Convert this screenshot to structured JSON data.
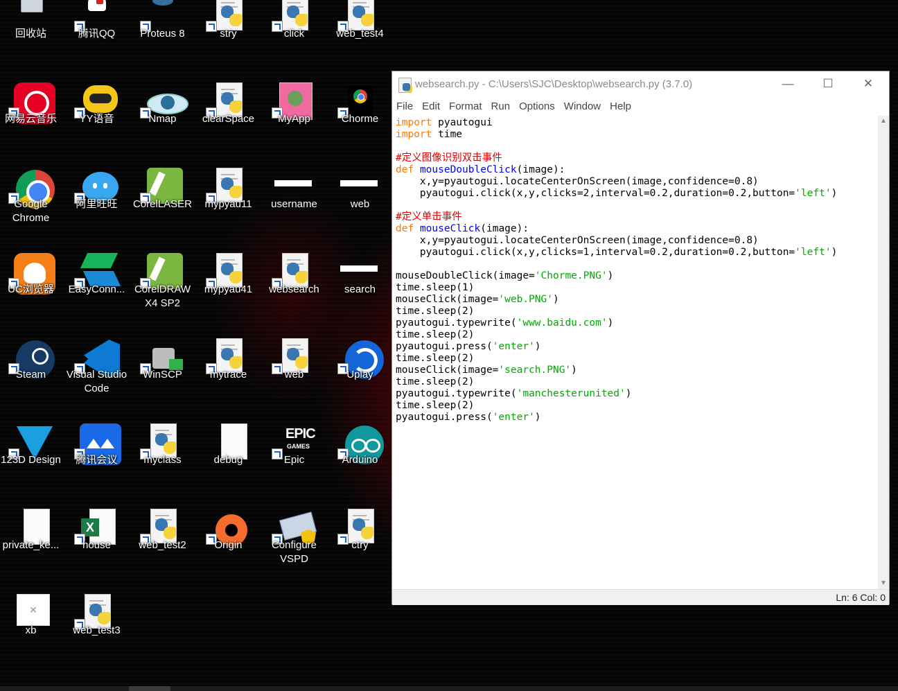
{
  "desktop": {
    "icons": [
      {
        "label": "回收站",
        "kind": "recycle"
      },
      {
        "label": "腾讯QQ",
        "kind": "qq"
      },
      {
        "label": "Proteus 8",
        "kind": "proteus"
      },
      {
        "label": "stry",
        "kind": "py"
      },
      {
        "label": "click",
        "kind": "py"
      },
      {
        "label": "web_test4",
        "kind": "py"
      },
      {
        "label": "网易云音乐",
        "kind": "netease"
      },
      {
        "label": "YY语音",
        "kind": "yy"
      },
      {
        "label": "Nmap",
        "kind": "nmap"
      },
      {
        "label": "clearSpace",
        "kind": "py"
      },
      {
        "label": "MyApp",
        "kind": "myapp"
      },
      {
        "label": "Chorme",
        "kind": "chorme"
      },
      {
        "label": "Google Chrome",
        "kind": "chrome"
      },
      {
        "label": "阿里旺旺",
        "kind": "aliww"
      },
      {
        "label": "CorelLASER",
        "kind": "corel"
      },
      {
        "label": "mypyau11",
        "kind": "py"
      },
      {
        "label": "username",
        "kind": "bar"
      },
      {
        "label": "web",
        "kind": "bar"
      },
      {
        "label": "UC浏览器",
        "kind": "uc"
      },
      {
        "label": "EasyConn...",
        "kind": "easyconn"
      },
      {
        "label": "CorelDRAW X4 SP2",
        "kind": "corel"
      },
      {
        "label": "mypyau41",
        "kind": "py"
      },
      {
        "label": "websearch",
        "kind": "py"
      },
      {
        "label": "search",
        "kind": "bar"
      },
      {
        "label": "Steam",
        "kind": "steam"
      },
      {
        "label": "Visual Studio Code",
        "kind": "vscode"
      },
      {
        "label": "WinSCP",
        "kind": "winscp"
      },
      {
        "label": "mytrace",
        "kind": "py"
      },
      {
        "label": "web",
        "kind": "py"
      },
      {
        "label": "Uplay",
        "kind": "uplay"
      },
      {
        "label": "123D Design",
        "kind": "d123"
      },
      {
        "label": "腾讯会议",
        "kind": "meeting"
      },
      {
        "label": "myclass",
        "kind": "py"
      },
      {
        "label": "debug",
        "kind": "doc"
      },
      {
        "label": "Epic",
        "kind": "epic"
      },
      {
        "label": "Arduino",
        "kind": "arduino"
      },
      {
        "label": "private_ke...",
        "kind": "doc"
      },
      {
        "label": "house",
        "kind": "excel"
      },
      {
        "label": "web_test2",
        "kind": "py"
      },
      {
        "label": "Origin",
        "kind": "origin"
      },
      {
        "label": "Configure VSPD",
        "kind": "vspd"
      },
      {
        "label": "ctry",
        "kind": "py"
      },
      {
        "label": "xb",
        "kind": "xb"
      },
      {
        "label": "web_test3",
        "kind": "py"
      }
    ]
  },
  "window": {
    "title": "websearch.py - C:\\Users\\SJC\\Desktop\\websearch.py (3.7.0)",
    "minimize": "—",
    "maximize": "☐",
    "close": "✕",
    "menu": [
      "File",
      "Edit",
      "Format",
      "Run",
      "Options",
      "Window",
      "Help"
    ],
    "code": [
      [
        {
          "t": "import",
          "c": "kw"
        },
        {
          "t": " pyautogui"
        }
      ],
      [
        {
          "t": "import",
          "c": "kw"
        },
        {
          "t": " time"
        }
      ],
      [],
      [
        {
          "t": "#定义图像识别双击事件",
          "c": "cm"
        }
      ],
      [
        {
          "t": "def",
          "c": "kw"
        },
        {
          "t": " "
        },
        {
          "t": "mouseDoubleClick",
          "c": "df"
        },
        {
          "t": "(image):"
        }
      ],
      [
        {
          "t": "    x,y=pyautogui.locateCenterOnScreen(image,confidence=0.8)"
        }
      ],
      [
        {
          "t": "    pyautogui.click(x,y,clicks=2,interval=0.2,duration=0.2,button="
        },
        {
          "t": "'left'",
          "c": "st"
        },
        {
          "t": ")"
        }
      ],
      [],
      [
        {
          "t": "#定义单击事件",
          "c": "cm"
        }
      ],
      [
        {
          "t": "def",
          "c": "kw"
        },
        {
          "t": " "
        },
        {
          "t": "mouseClick",
          "c": "df"
        },
        {
          "t": "(image):"
        }
      ],
      [
        {
          "t": "    x,y=pyautogui.locateCenterOnScreen(image,confidence=0.8)"
        }
      ],
      [
        {
          "t": "    pyautogui.click(x,y,clicks=1,interval=0.2,duration=0.2,button="
        },
        {
          "t": "'left'",
          "c": "st"
        },
        {
          "t": ")"
        }
      ],
      [],
      [
        {
          "t": "mouseDoubleClick(image="
        },
        {
          "t": "'Chorme.PNG'",
          "c": "st"
        },
        {
          "t": ")"
        }
      ],
      [
        {
          "t": "time.sleep(1)"
        }
      ],
      [
        {
          "t": "mouseClick(image="
        },
        {
          "t": "'web.PNG'",
          "c": "st"
        },
        {
          "t": ")"
        }
      ],
      [
        {
          "t": "time.sleep(2)"
        }
      ],
      [
        {
          "t": "pyautogui.typewrite("
        },
        {
          "t": "'www.baidu.com'",
          "c": "st"
        },
        {
          "t": ")"
        }
      ],
      [
        {
          "t": "time.sleep(2)"
        }
      ],
      [
        {
          "t": "pyautogui.press("
        },
        {
          "t": "'enter'",
          "c": "st"
        },
        {
          "t": ")"
        }
      ],
      [
        {
          "t": "time.sleep(2)"
        }
      ],
      [
        {
          "t": "mouseClick(image="
        },
        {
          "t": "'search.PNG'",
          "c": "st"
        },
        {
          "t": ")"
        }
      ],
      [
        {
          "t": "time.sleep(2)"
        }
      ],
      [
        {
          "t": "pyautogui.typewrite("
        },
        {
          "t": "'manchesterunited'",
          "c": "st"
        },
        {
          "t": ")"
        }
      ],
      [
        {
          "t": "time.sleep(2)"
        }
      ],
      [
        {
          "t": "pyautogui.press("
        },
        {
          "t": "'enter'",
          "c": "st"
        },
        {
          "t": ")"
        }
      ]
    ],
    "status": "Ln: 6   Col: 0"
  },
  "colors": {
    "keyword": "#ff7700",
    "comment": "#dd0000",
    "defname": "#0000ff",
    "string": "#00aa00"
  }
}
